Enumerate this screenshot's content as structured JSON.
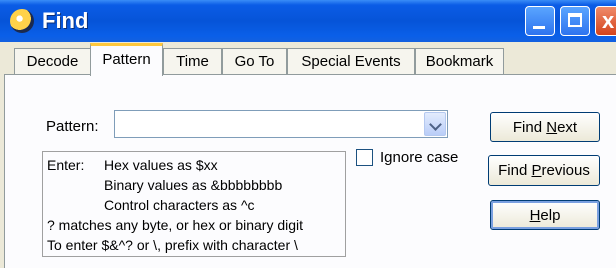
{
  "window": {
    "title": "Find",
    "icons": {
      "app": "app-icon",
      "minimize": "minimize-icon",
      "maximize": "maximize-icon",
      "close": "close-icon"
    },
    "close_glyph": "x"
  },
  "tabs": [
    {
      "label": "Decode",
      "active": false
    },
    {
      "label": "Pattern",
      "active": true
    },
    {
      "label": "Time",
      "active": false
    },
    {
      "label": "Go To",
      "active": false
    },
    {
      "label": "Special Events",
      "active": false
    },
    {
      "label": "Bookmark",
      "active": false
    }
  ],
  "pattern": {
    "label": "Pattern:",
    "value": ""
  },
  "help_text": {
    "enter_label": "Enter:",
    "hex": "Hex values as $xx",
    "binary": "Binary values as &bbbbbbbb",
    "control": "Control characters as ^c",
    "match": "? matches any byte, or hex or binary digit",
    "escape": "To enter $&^? or \\, prefix with character \\"
  },
  "ignore_case": {
    "label": "Ignore case",
    "checked": false
  },
  "buttons": {
    "find_next": {
      "pre": "Find ",
      "ul": "N",
      "post": "ext"
    },
    "find_previous": {
      "pre": "Find ",
      "ul": "P",
      "post": "revious"
    },
    "help": {
      "pre": "",
      "ul": "H",
      "post": "elp"
    }
  }
}
